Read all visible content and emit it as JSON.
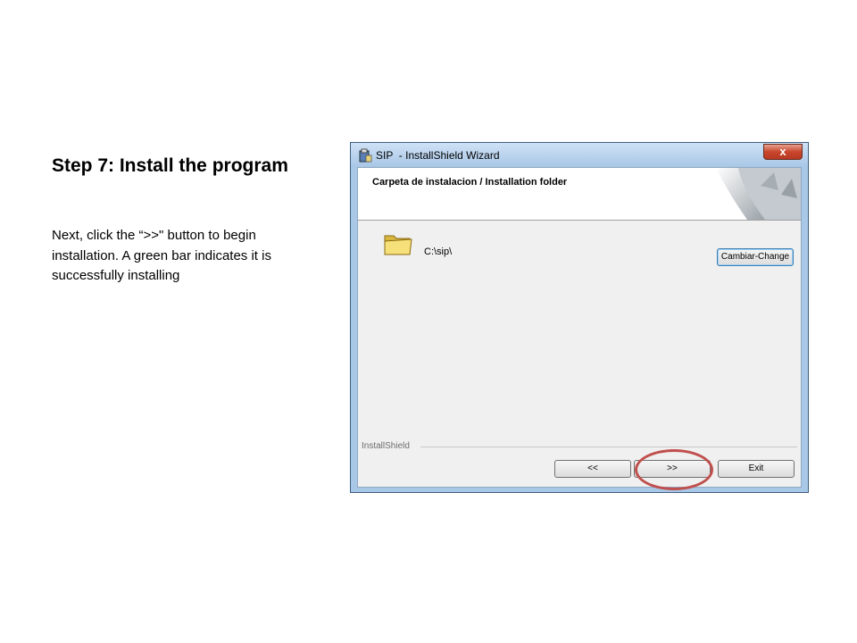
{
  "slide": {
    "title": "Step 7: Install the program",
    "body": "Next, click the “>>\" button to begin installation. A green bar indicates it is successfully installing"
  },
  "window": {
    "title": "SIP  - InstallShield Wizard",
    "close_label": "x",
    "header_title": "Carpeta de instalacion / Installation folder",
    "folder_path": "C:\\sip\\",
    "change_button": "Cambiar-Change",
    "group_label": "InstallShield",
    "back_button": "<<",
    "next_button": ">>",
    "exit_button": "Exit"
  },
  "colors": {
    "annotation_ring": "#c0504d",
    "titlebar": "#a8c7e6",
    "close_button": "#c9462c"
  },
  "icons": [
    "installer-icon",
    "close-icon",
    "folder-icon",
    "page-curl-graphic"
  ]
}
